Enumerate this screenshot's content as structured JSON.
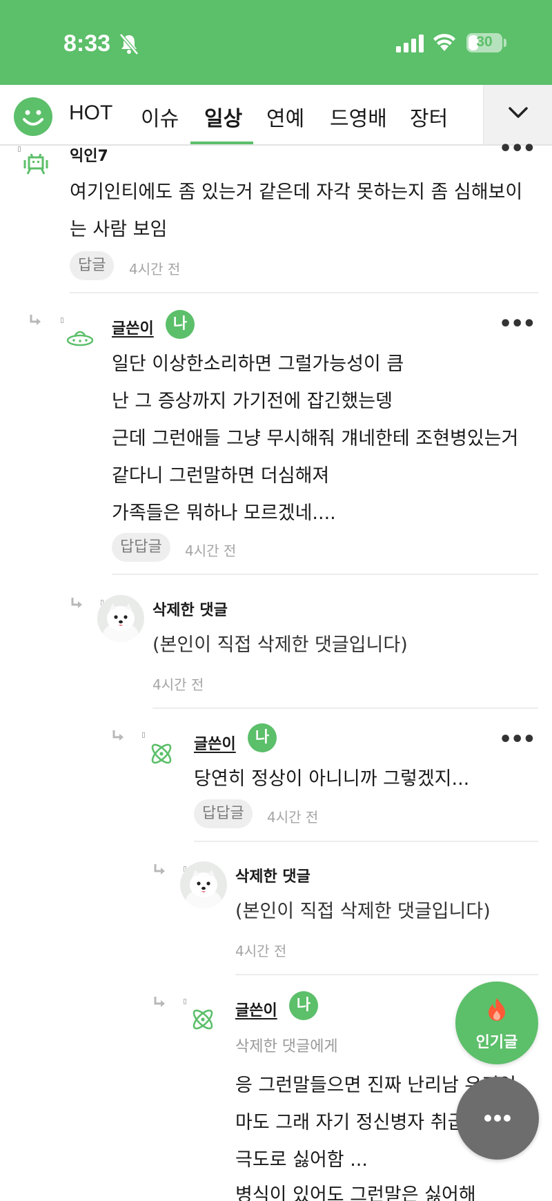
{
  "status_bar": {
    "time": "8:33",
    "battery": "30",
    "battery_level": 0.3
  },
  "tabs": [
    {
      "label": "HOT"
    },
    {
      "label": "이슈"
    },
    {
      "label": "일상",
      "active": true
    },
    {
      "label": "연예"
    },
    {
      "label": "드영배"
    },
    {
      "label": "장터"
    }
  ],
  "colors": {
    "brand": "#5cbf6a",
    "fab_menu": "#6d6d6d"
  },
  "comments": [
    {
      "nick": "익인7",
      "icon": "space-invader-icon",
      "lines": [
        "여기인티에도 좀 있는거 같은데 자각 못하는지 좀 심해보이",
        "는 사람 보임"
      ],
      "reply_label": "답글",
      "time": "4시간 전"
    },
    {
      "nick": "글쓴이",
      "badge": "나",
      "icon": "ufo-icon",
      "lines": [
        "일단 이상한소리하면 그럴가능성이 큼",
        "난 그 증상까지 가기전에 잡긴했는뎅",
        "근데 그런애들 그냥 무시해줘 걔네한테 조현병있는거",
        "같다니 그런말하면 더심해져",
        "가족들은 뭐하나 모르겠네...."
      ],
      "reply_label": "답답글",
      "time": "4시간 전"
    },
    {
      "nick": "삭제한 댓글",
      "icon": "dog-photo-avatar",
      "lines": [
        "(본인이 직접 삭제한 댓글입니다)"
      ],
      "time": "4시간 전"
    },
    {
      "nick": "글쓴이",
      "badge": "나",
      "icon": "atom-icon",
      "lines": [
        "당연히 정상이 아니니까 그렇겠지..."
      ],
      "reply_label": "답답글",
      "time": "4시간 전"
    },
    {
      "nick": "삭제한 댓글",
      "icon": "dog-photo-avatar",
      "lines": [
        "(본인이 직접 삭제한 댓글입니다)"
      ],
      "time": "4시간 전"
    },
    {
      "nick": "글쓴이",
      "badge": "나",
      "icon": "atom-icon",
      "to": "삭제한 댓글에게",
      "lines": [
        "응 그런말들으면 진짜 난리남 우리엄",
        "마도 그래 자기 정신병자 취급",
        "극도로 싫어함 ...",
        "병식이 있어도 그런말은 싫어해"
      ]
    }
  ],
  "fab": {
    "popular_label": "인기글"
  }
}
